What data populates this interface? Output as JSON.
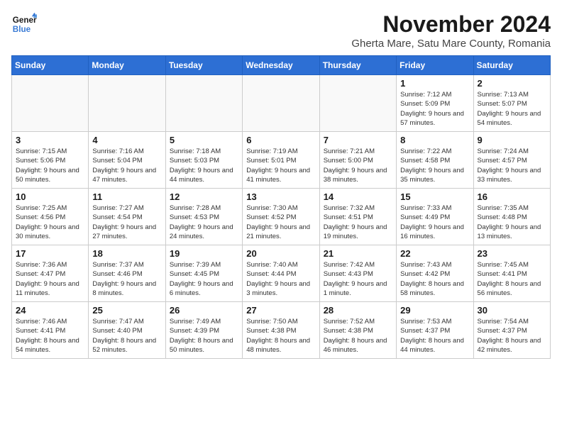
{
  "logo": {
    "line1": "General",
    "line2": "Blue"
  },
  "title": "November 2024",
  "location": "Gherta Mare, Satu Mare County, Romania",
  "days_of_week": [
    "Sunday",
    "Monday",
    "Tuesday",
    "Wednesday",
    "Thursday",
    "Friday",
    "Saturday"
  ],
  "weeks": [
    [
      {
        "day": "",
        "info": ""
      },
      {
        "day": "",
        "info": ""
      },
      {
        "day": "",
        "info": ""
      },
      {
        "day": "",
        "info": ""
      },
      {
        "day": "",
        "info": ""
      },
      {
        "day": "1",
        "info": "Sunrise: 7:12 AM\nSunset: 5:09 PM\nDaylight: 9 hours and 57 minutes."
      },
      {
        "day": "2",
        "info": "Sunrise: 7:13 AM\nSunset: 5:07 PM\nDaylight: 9 hours and 54 minutes."
      }
    ],
    [
      {
        "day": "3",
        "info": "Sunrise: 7:15 AM\nSunset: 5:06 PM\nDaylight: 9 hours and 50 minutes."
      },
      {
        "day": "4",
        "info": "Sunrise: 7:16 AM\nSunset: 5:04 PM\nDaylight: 9 hours and 47 minutes."
      },
      {
        "day": "5",
        "info": "Sunrise: 7:18 AM\nSunset: 5:03 PM\nDaylight: 9 hours and 44 minutes."
      },
      {
        "day": "6",
        "info": "Sunrise: 7:19 AM\nSunset: 5:01 PM\nDaylight: 9 hours and 41 minutes."
      },
      {
        "day": "7",
        "info": "Sunrise: 7:21 AM\nSunset: 5:00 PM\nDaylight: 9 hours and 38 minutes."
      },
      {
        "day": "8",
        "info": "Sunrise: 7:22 AM\nSunset: 4:58 PM\nDaylight: 9 hours and 35 minutes."
      },
      {
        "day": "9",
        "info": "Sunrise: 7:24 AM\nSunset: 4:57 PM\nDaylight: 9 hours and 33 minutes."
      }
    ],
    [
      {
        "day": "10",
        "info": "Sunrise: 7:25 AM\nSunset: 4:56 PM\nDaylight: 9 hours and 30 minutes."
      },
      {
        "day": "11",
        "info": "Sunrise: 7:27 AM\nSunset: 4:54 PM\nDaylight: 9 hours and 27 minutes."
      },
      {
        "day": "12",
        "info": "Sunrise: 7:28 AM\nSunset: 4:53 PM\nDaylight: 9 hours and 24 minutes."
      },
      {
        "day": "13",
        "info": "Sunrise: 7:30 AM\nSunset: 4:52 PM\nDaylight: 9 hours and 21 minutes."
      },
      {
        "day": "14",
        "info": "Sunrise: 7:32 AM\nSunset: 4:51 PM\nDaylight: 9 hours and 19 minutes."
      },
      {
        "day": "15",
        "info": "Sunrise: 7:33 AM\nSunset: 4:49 PM\nDaylight: 9 hours and 16 minutes."
      },
      {
        "day": "16",
        "info": "Sunrise: 7:35 AM\nSunset: 4:48 PM\nDaylight: 9 hours and 13 minutes."
      }
    ],
    [
      {
        "day": "17",
        "info": "Sunrise: 7:36 AM\nSunset: 4:47 PM\nDaylight: 9 hours and 11 minutes."
      },
      {
        "day": "18",
        "info": "Sunrise: 7:37 AM\nSunset: 4:46 PM\nDaylight: 9 hours and 8 minutes."
      },
      {
        "day": "19",
        "info": "Sunrise: 7:39 AM\nSunset: 4:45 PM\nDaylight: 9 hours and 6 minutes."
      },
      {
        "day": "20",
        "info": "Sunrise: 7:40 AM\nSunset: 4:44 PM\nDaylight: 9 hours and 3 minutes."
      },
      {
        "day": "21",
        "info": "Sunrise: 7:42 AM\nSunset: 4:43 PM\nDaylight: 9 hours and 1 minute."
      },
      {
        "day": "22",
        "info": "Sunrise: 7:43 AM\nSunset: 4:42 PM\nDaylight: 8 hours and 58 minutes."
      },
      {
        "day": "23",
        "info": "Sunrise: 7:45 AM\nSunset: 4:41 PM\nDaylight: 8 hours and 56 minutes."
      }
    ],
    [
      {
        "day": "24",
        "info": "Sunrise: 7:46 AM\nSunset: 4:41 PM\nDaylight: 8 hours and 54 minutes."
      },
      {
        "day": "25",
        "info": "Sunrise: 7:47 AM\nSunset: 4:40 PM\nDaylight: 8 hours and 52 minutes."
      },
      {
        "day": "26",
        "info": "Sunrise: 7:49 AM\nSunset: 4:39 PM\nDaylight: 8 hours and 50 minutes."
      },
      {
        "day": "27",
        "info": "Sunrise: 7:50 AM\nSunset: 4:38 PM\nDaylight: 8 hours and 48 minutes."
      },
      {
        "day": "28",
        "info": "Sunrise: 7:52 AM\nSunset: 4:38 PM\nDaylight: 8 hours and 46 minutes."
      },
      {
        "day": "29",
        "info": "Sunrise: 7:53 AM\nSunset: 4:37 PM\nDaylight: 8 hours and 44 minutes."
      },
      {
        "day": "30",
        "info": "Sunrise: 7:54 AM\nSunset: 4:37 PM\nDaylight: 8 hours and 42 minutes."
      }
    ]
  ]
}
